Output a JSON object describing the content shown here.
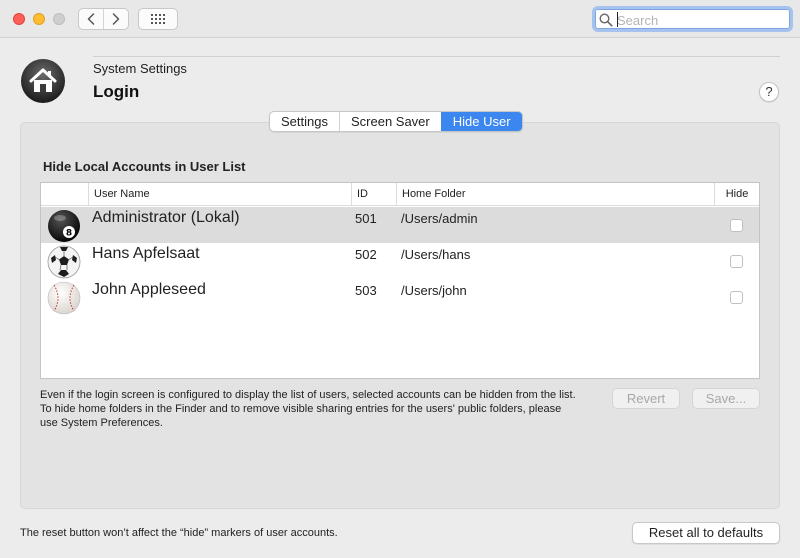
{
  "titlebar": {
    "search_placeholder": "Search"
  },
  "header": {
    "subtitle": "System Settings",
    "title": "Login",
    "help_label": "?"
  },
  "tabs": [
    {
      "label": "Settings",
      "active": false
    },
    {
      "label": "Screen Saver",
      "active": false
    },
    {
      "label": "Hide User",
      "active": true
    }
  ],
  "section": {
    "title": "Hide Local Accounts in User List"
  },
  "table": {
    "columns": [
      "User Name",
      "ID",
      "Home Folder",
      "Hide"
    ],
    "rows": [
      {
        "name": "Administrator (Lokal)",
        "id": "501",
        "home": "/Users/admin",
        "hidden": false,
        "avatar": "eight-ball",
        "selected": true
      },
      {
        "name": "Hans Apfelsaat",
        "id": "502",
        "home": "/Users/hans",
        "hidden": false,
        "avatar": "soccer-ball",
        "selected": false
      },
      {
        "name": "John Appleseed",
        "id": "503",
        "home": "/Users/john",
        "hidden": false,
        "avatar": "baseball",
        "selected": false
      }
    ]
  },
  "description": "Even if the login screen is configured to display the list of users, selected accounts can be hidden from the list. To hide home folders in the Finder and to remove visible sharing entries for the users' public folders, please use System Preferences.",
  "buttons": {
    "revert": "Revert",
    "save": "Save...",
    "reset": "Reset all to defaults"
  },
  "footer_note": "The reset button won’t affect the “hide” markers of user accounts.",
  "colors": {
    "accent": "#3b86ef",
    "close": "#fe5f57",
    "minimize": "#febc2e"
  }
}
